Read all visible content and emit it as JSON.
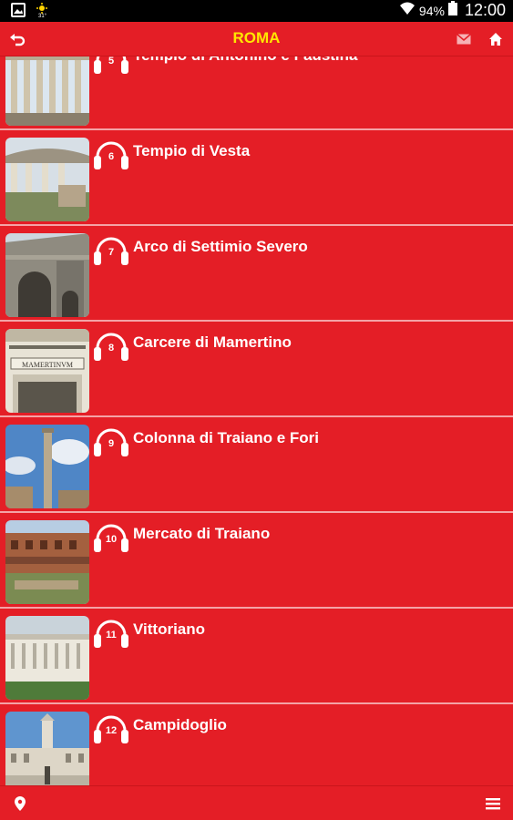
{
  "status_bar": {
    "battery": "94%",
    "time": "12:00"
  },
  "header": {
    "title": "ROMA"
  },
  "icons": {
    "back": "back-arrow-icon",
    "mail": "mail-icon",
    "home": "home-icon",
    "map_pin": "map-pin-icon",
    "menu": "menu-icon",
    "audio": "headphones-icon"
  },
  "colors": {
    "primary": "#e41e26",
    "title": "#ffe600",
    "text": "#ffffff",
    "separator": "#f4a3a6"
  },
  "stops": [
    {
      "number": "5",
      "title": "Tempio di Antonino e Faustina"
    },
    {
      "number": "6",
      "title": "Tempio di Vesta"
    },
    {
      "number": "7",
      "title": "Arco di Settimio Severo"
    },
    {
      "number": "8",
      "title": "Carcere di Mamertino"
    },
    {
      "number": "9",
      "title": "Colonna di Traiano e Fori"
    },
    {
      "number": "10",
      "title": "Mercato di Traiano"
    },
    {
      "number": "11",
      "title": "Vittoriano"
    },
    {
      "number": "12",
      "title": "Campidoglio"
    }
  ],
  "thumbnail_captions": {
    "stop_8": "MAMERTINVM"
  }
}
